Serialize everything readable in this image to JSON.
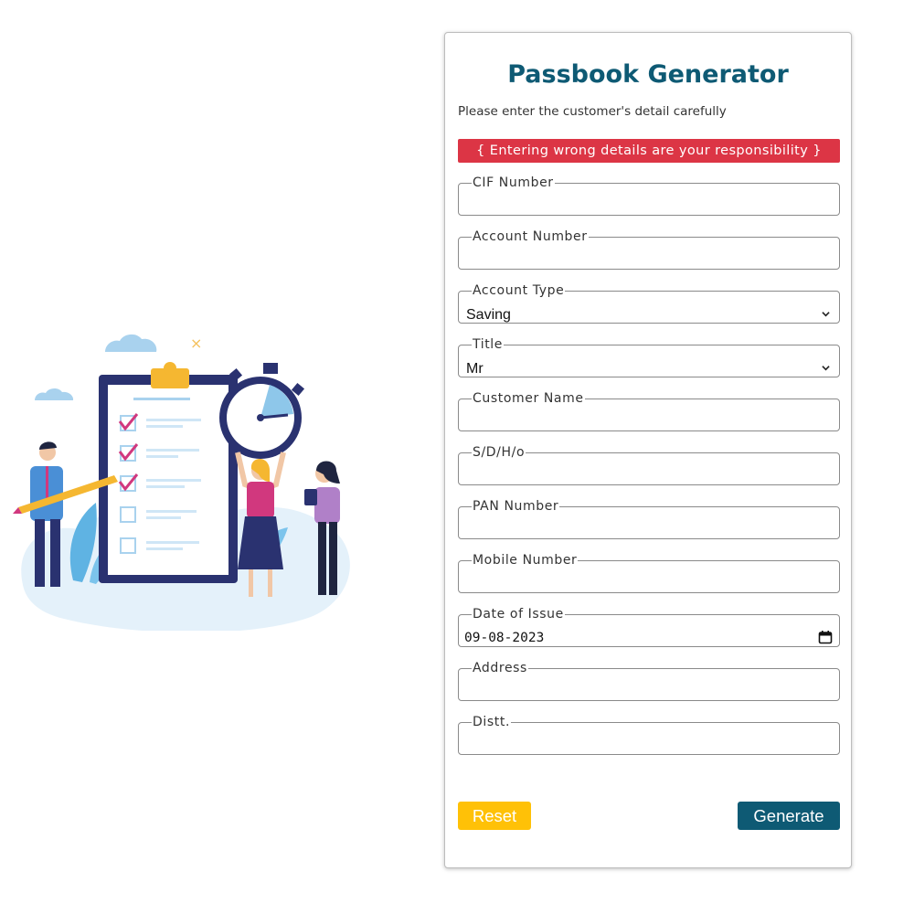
{
  "form": {
    "title": "Passbook Generator",
    "subtitle": "Please enter the customer's detail carefully",
    "warning": "{ Entering wrong details are your responsibility }",
    "fields": [
      {
        "label": "CIF Number",
        "value": ""
      },
      {
        "label": "Account Number",
        "value": ""
      },
      {
        "label": "Account Type",
        "value": "Saving"
      },
      {
        "label": "Title",
        "value": "Mr"
      },
      {
        "label": "Customer Name",
        "value": ""
      },
      {
        "label": "S/D/H/o",
        "value": ""
      },
      {
        "label": "PAN Number",
        "value": ""
      },
      {
        "label": "Mobile Number",
        "value": ""
      },
      {
        "label": "Date of Issue",
        "value": "09-08-2023"
      },
      {
        "label": "Address",
        "value": ""
      },
      {
        "label": "Distt.",
        "value": ""
      }
    ],
    "reset_label": "Reset",
    "generate_label": "Generate"
  },
  "colors": {
    "title": "#0e5a74",
    "warning_bg": "#dc3545",
    "reset_bg": "#ffc107",
    "generate_bg": "#0e5a74"
  },
  "icons": {
    "select": "chevron-down-icon",
    "date": "calendar-icon"
  }
}
